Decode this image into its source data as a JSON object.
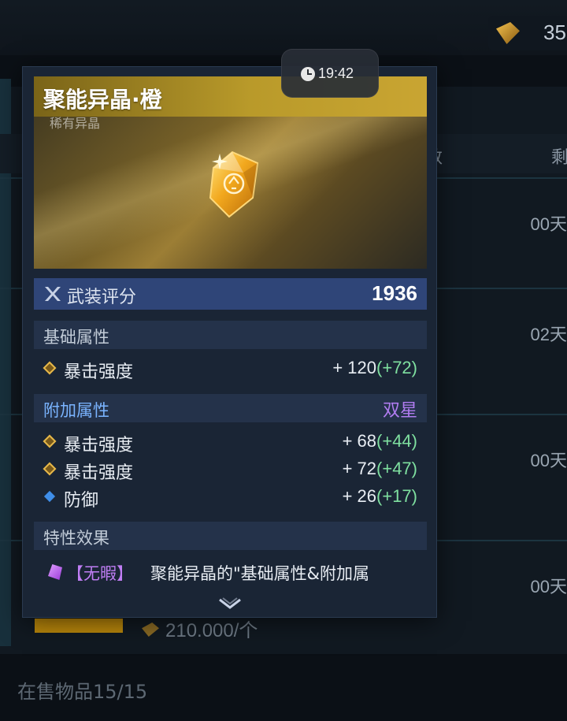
{
  "background": {
    "currency_value": "35",
    "column_header_partial": "数",
    "column_header_right": "剩",
    "rows": [
      {
        "stock": "00天"
      },
      {
        "stock": "02天"
      },
      {
        "stock": "00天"
      },
      {
        "stock": "00天"
      }
    ],
    "price_text": "210.000/个",
    "footer_text": "在售物品15/15"
  },
  "status": {
    "time": "19:42"
  },
  "item": {
    "name": "聚能异晶·橙",
    "subtitle": "稀有异晶",
    "score_label": "武装评分",
    "score_value": "1936",
    "base_section_label": "基础属性",
    "base_stats": [
      {
        "name": "暴击强度",
        "value": "+ 120",
        "bonus": "(+72)",
        "icon": "gold-diamond-icon"
      }
    ],
    "extra_section_label": "附加属性",
    "extra_section_badge": "双星",
    "extra_stats": [
      {
        "name": "暴击强度",
        "value": "+ 68",
        "bonus": "(+44)",
        "icon": "gold-diamond-icon"
      },
      {
        "name": "暴击强度",
        "value": "+ 72",
        "bonus": "(+47)",
        "icon": "gold-diamond-icon"
      },
      {
        "name": "防御",
        "value": "+ 26",
        "bonus": "(+17)",
        "icon": "blue-diamond-icon"
      }
    ],
    "trait_section_label": "特性效果",
    "trait": {
      "tag": "【无暇】",
      "description": "聚能异晶的\"基础属性&附加属"
    }
  },
  "colors": {
    "panel_bg": "#1a2535",
    "score_bar": "#2f4578",
    "bonus_green": "#7fe0a0",
    "purple_accent": "#b07cf0",
    "gold_title": "#b99a2a"
  }
}
